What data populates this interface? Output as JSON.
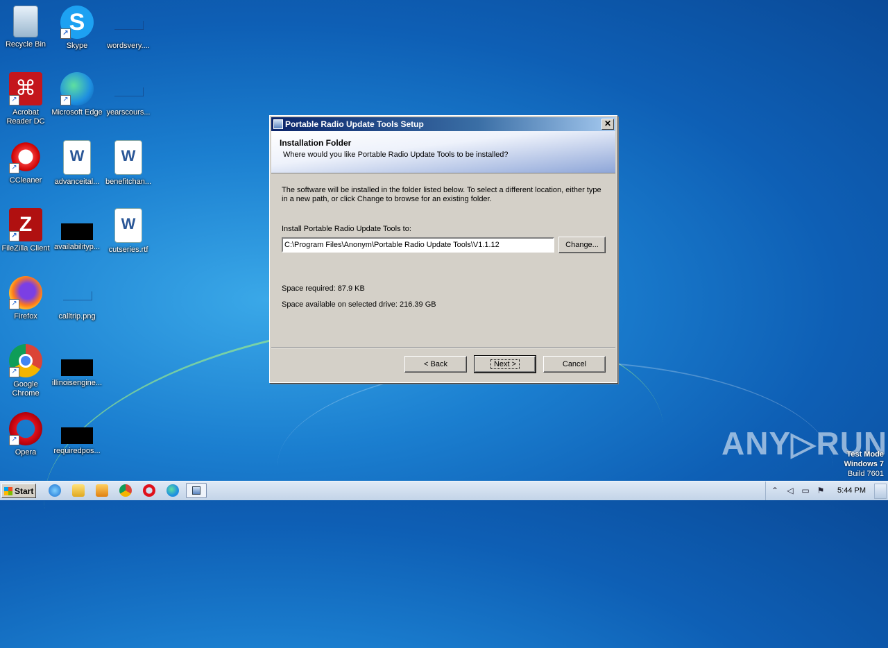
{
  "desktop": {
    "icons": [
      {
        "label": "Recycle Bin"
      },
      {
        "label": "Skype"
      },
      {
        "label": "wordsvery...."
      },
      {
        "label": "Acrobat Reader DC"
      },
      {
        "label": "Microsoft Edge"
      },
      {
        "label": "yearscours..."
      },
      {
        "label": "CCleaner"
      },
      {
        "label": "advanceital..."
      },
      {
        "label": "benefitchan..."
      },
      {
        "label": "FileZilla Client"
      },
      {
        "label": "availabilityp..."
      },
      {
        "label": "cutseries.rtf"
      },
      {
        "label": "Firefox"
      },
      {
        "label": "calltrip.png"
      },
      {
        "label": "Google Chrome"
      },
      {
        "label": "illinoisengine..."
      },
      {
        "label": "Opera"
      },
      {
        "label": "requiredpos..."
      }
    ]
  },
  "dialog": {
    "title": "Portable Radio Update Tools Setup",
    "close_glyph": "✕",
    "header_title": "Installation Folder",
    "header_subtitle": "Where would you like Portable Radio Update Tools to be installed?",
    "body_text": "The software will be installed in the folder listed below. To select a different location, either type in a new path, or click Change to browse for an existing folder.",
    "install_label": "Install Portable Radio Update Tools to:",
    "install_path": "C:\\Program Files\\Anonym\\Portable Radio Update Tools\\V1.1.12",
    "change_button": "Change...",
    "space_required": "Space required: 87.9 KB",
    "space_available": "Space available on selected drive: 216.39 GB",
    "back_button": "< Back",
    "next_button": "Next >",
    "cancel_button": "Cancel"
  },
  "watermark": {
    "text": "ANY▷RUN",
    "test_mode": "Test Mode",
    "os": "Windows 7",
    "build": "Build 7601"
  },
  "taskbar": {
    "start_label": "Start",
    "clock": "5:44 PM"
  }
}
